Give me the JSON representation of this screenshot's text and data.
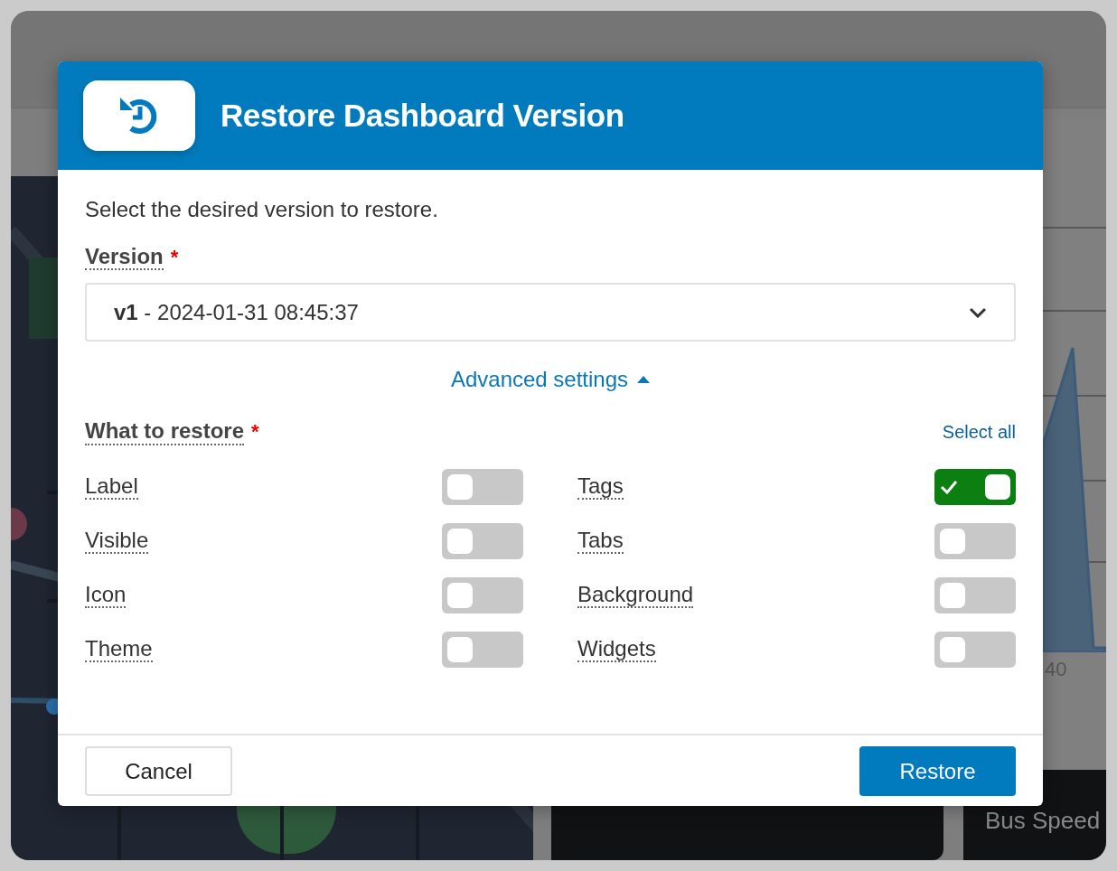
{
  "background": {
    "chart_tick": "40",
    "card_title": "Bus Speed"
  },
  "dialog": {
    "title": "Restore Dashboard Version",
    "description": "Select the desired version to restore.",
    "version": {
      "label": "Version",
      "required": "*",
      "value": "**v1** - 2024-01-31 08:45:37"
    },
    "advanced": {
      "label": "Advanced settings",
      "expanded": true
    },
    "restore_section": {
      "label": "What to restore",
      "required": "*",
      "select_all": "Select all"
    },
    "options": [
      {
        "label": "Label",
        "on": false
      },
      {
        "label": "Tags",
        "on": true
      },
      {
        "label": "Visible",
        "on": false
      },
      {
        "label": "Tabs",
        "on": false
      },
      {
        "label": "Icon",
        "on": false
      },
      {
        "label": "Background",
        "on": false
      },
      {
        "label": "Theme",
        "on": false
      },
      {
        "label": "Widgets",
        "on": false
      }
    ],
    "buttons": {
      "cancel": "Cancel",
      "confirm": "Restore"
    }
  }
}
